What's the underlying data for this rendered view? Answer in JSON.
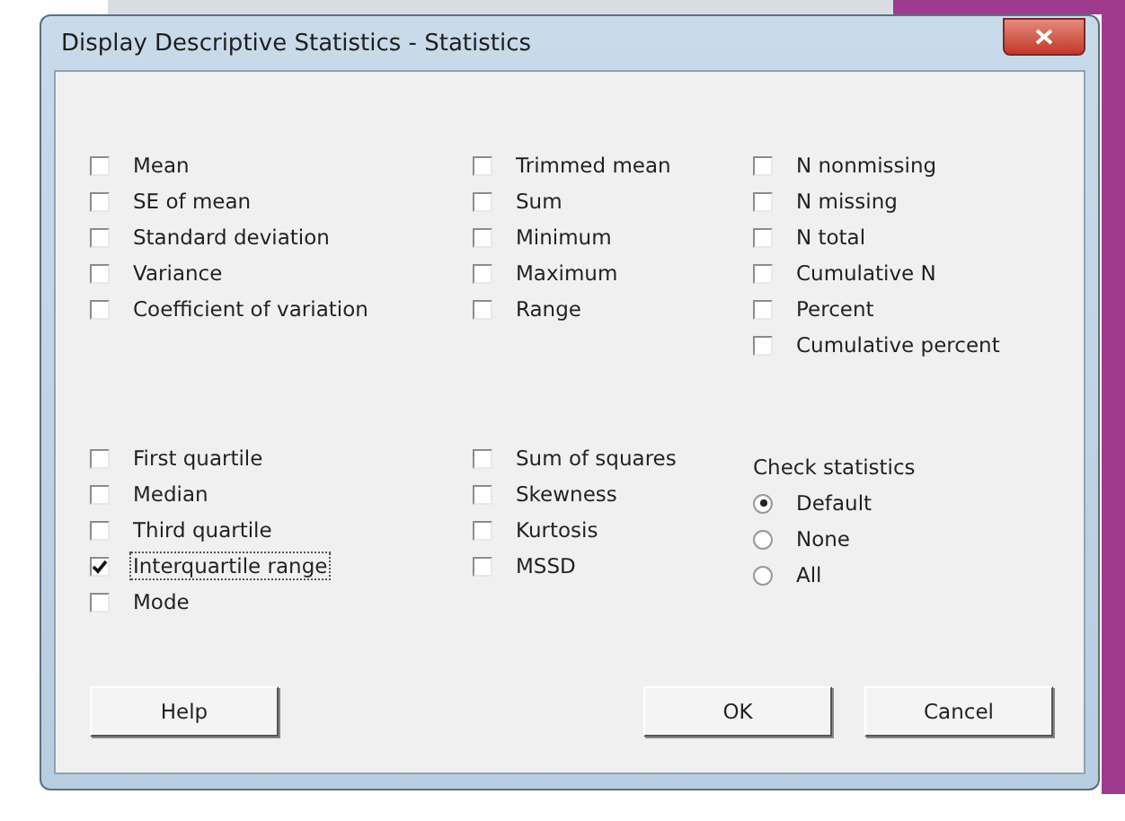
{
  "window": {
    "title": "Display Descriptive Statistics - Statistics"
  },
  "upper_columns": [
    [
      {
        "label": "Mean",
        "checked": false
      },
      {
        "label": "SE of mean",
        "checked": false
      },
      {
        "label": "Standard deviation",
        "checked": false
      },
      {
        "label": "Variance",
        "checked": false
      },
      {
        "label": "Coefficient of variation",
        "checked": false
      }
    ],
    [
      {
        "label": "Trimmed mean",
        "checked": false
      },
      {
        "label": "Sum",
        "checked": false
      },
      {
        "label": "Minimum",
        "checked": false
      },
      {
        "label": "Maximum",
        "checked": false
      },
      {
        "label": "Range",
        "checked": false
      }
    ],
    [
      {
        "label": "N nonmissing",
        "checked": false
      },
      {
        "label": "N missing",
        "checked": false
      },
      {
        "label": "N total",
        "checked": false
      },
      {
        "label": "Cumulative N",
        "checked": false
      },
      {
        "label": "Percent",
        "checked": false
      },
      {
        "label": "Cumulative percent",
        "checked": false
      }
    ]
  ],
  "lower_columns": [
    [
      {
        "label": "First quartile",
        "checked": false
      },
      {
        "label": "Median",
        "checked": false
      },
      {
        "label": "Third quartile",
        "checked": false
      },
      {
        "label": "Interquartile range",
        "checked": true
      },
      {
        "label": "Mode",
        "checked": false
      }
    ],
    [
      {
        "label": "Sum of squares",
        "checked": false
      },
      {
        "label": "Skewness",
        "checked": false
      },
      {
        "label": "Kurtosis",
        "checked": false
      },
      {
        "label": "MSSD",
        "checked": false
      }
    ]
  ],
  "check_statistics": {
    "label": "Check statistics",
    "options": [
      {
        "label": "Default",
        "selected": true
      },
      {
        "label": "None",
        "selected": false
      },
      {
        "label": "All",
        "selected": false
      }
    ]
  },
  "buttons": [
    {
      "label": "Help",
      "kind": "left"
    },
    {
      "label": "OK",
      "kind": "right"
    },
    {
      "label": "Cancel",
      "kind": "right"
    }
  ]
}
